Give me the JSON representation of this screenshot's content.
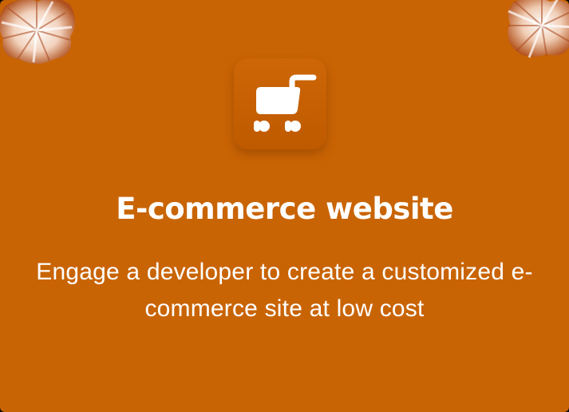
{
  "card": {
    "title": "E-commerce website",
    "description": "Engage a developer to create a customized e-commerce site at low cost",
    "icon": "shopping-cart-icon",
    "decoration": "metallic-flower-icon"
  },
  "colors": {
    "card_background": "#c96404",
    "icon_tile": "#c65f02",
    "text": "#ffffff",
    "frame": "#0c0c0c"
  }
}
